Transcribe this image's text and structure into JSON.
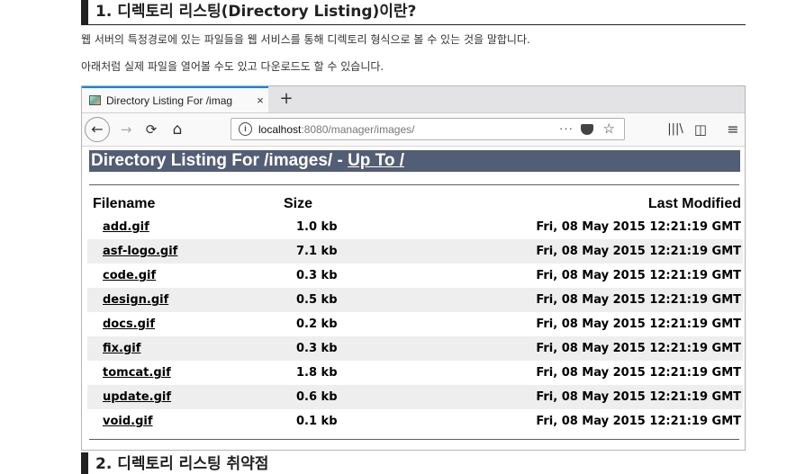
{
  "article": {
    "heading1": "1. 디렉토리 리스팅(Directory Listing)이란?",
    "para1": "웹 서버의 특정경로에 있는 파일들을 웹 서비스를 통해 디렉토리 형식으로 볼 수 있는 것을 말합니다.",
    "para2": "아래처럼 실제 파일을 열어볼 수도 있고 다운로드도 할 수 있습니다.",
    "heading2": "2. 디렉토리 리스팅 취약점"
  },
  "browser": {
    "tab": {
      "title": "Directory Listing For /imag",
      "close": "×"
    },
    "newtab": "+",
    "nav": {
      "back": "←",
      "forward": "→",
      "reload": "⟳",
      "home": "⌂"
    },
    "url": {
      "host": "localhost",
      "rest": ":8080/manager/images/",
      "more": "···"
    },
    "toolbar": {
      "library": "|||\\",
      "sidebar": "◫",
      "menu": "≡"
    },
    "icons": {
      "tab_favicon": "image-file-icon",
      "info": "info-icon",
      "pocket": "pocket-icon",
      "bookmark": "star-icon"
    }
  },
  "listing": {
    "title_prefix": "Directory Listing For /images/ - ",
    "up_link": "Up To /",
    "columns": {
      "name": "Filename",
      "size": "Size",
      "modified": "Last Modified"
    },
    "rows": [
      {
        "name": "add.gif",
        "size": "1.0 kb",
        "modified": "Fri, 08 May 2015 12:21:19 GMT"
      },
      {
        "name": "asf-logo.gif",
        "size": "7.1 kb",
        "modified": "Fri, 08 May 2015 12:21:19 GMT"
      },
      {
        "name": "code.gif",
        "size": "0.3 kb",
        "modified": "Fri, 08 May 2015 12:21:19 GMT"
      },
      {
        "name": "design.gif",
        "size": "0.5 kb",
        "modified": "Fri, 08 May 2015 12:21:19 GMT"
      },
      {
        "name": "docs.gif",
        "size": "0.2 kb",
        "modified": "Fri, 08 May 2015 12:21:19 GMT"
      },
      {
        "name": "fix.gif",
        "size": "0.3 kb",
        "modified": "Fri, 08 May 2015 12:21:19 GMT"
      },
      {
        "name": "tomcat.gif",
        "size": "1.8 kb",
        "modified": "Fri, 08 May 2015 12:21:19 GMT"
      },
      {
        "name": "update.gif",
        "size": "0.6 kb",
        "modified": "Fri, 08 May 2015 12:21:19 GMT"
      },
      {
        "name": "void.gif",
        "size": "0.1 kb",
        "modified": "Fri, 08 May 2015 12:21:19 GMT"
      }
    ]
  },
  "colors": {
    "tomcat_header": "#525d76",
    "tab_accent": "#0a84ff",
    "row_alt": "#eeeeee"
  }
}
